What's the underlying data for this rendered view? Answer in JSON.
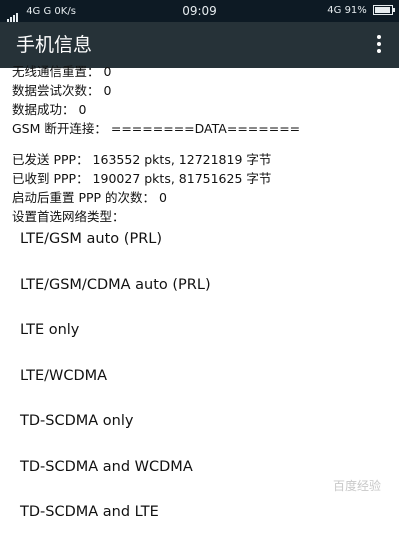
{
  "status_bar": {
    "left": "4G  G  0K/s",
    "time": "09:09",
    "right": "4G  91%",
    "battery_level": 0.91
  },
  "app_bar": {
    "title": "手机信息",
    "menu_icon": "more-vert-icon"
  },
  "info_rows": [
    "无线通信重置： 0",
    "数据尝试次数： 0",
    "数据成功： 0",
    "GSM 断开连接： ========DATA=======",
    "已发送 PPP： 163552 pkts, 12721819 字节",
    "已收到 PPP： 190027 pkts, 81751625 字节",
    "启动后重置 PPP 的次数： 0",
    "设置首选网络类型："
  ],
  "network_options": [
    "LTE/GSM auto (PRL)",
    "LTE/GSM/CDMA auto (PRL)",
    "LTE only",
    "LTE/WCDMA",
    "TD-SCDMA only",
    "TD-SCDMA and WCDMA",
    "TD-SCDMA and LTE"
  ],
  "watermark": "百度经验"
}
